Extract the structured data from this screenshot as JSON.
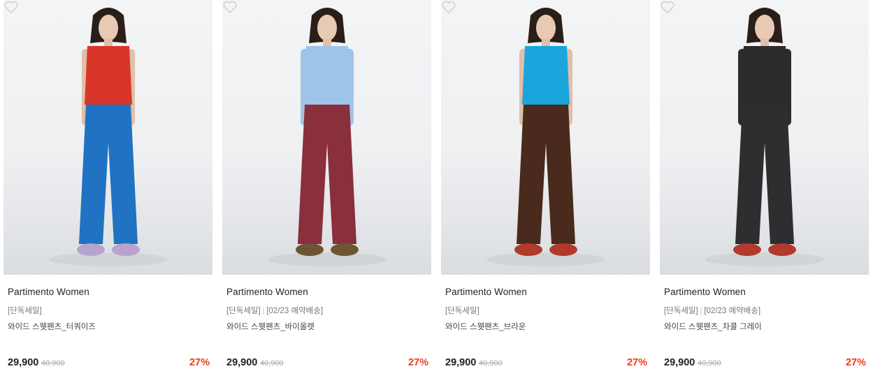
{
  "colors": {
    "discount": "#ee3c1d",
    "brand_text": "#222222",
    "muted": "#777777"
  },
  "products": [
    {
      "brand": "Partimento Women",
      "tag1": "[단독세일]",
      "tag2": "",
      "name": "와이드 스웻팬츠_터쿼이즈",
      "price": "29,900",
      "original_price": "40,900",
      "discount": "27%",
      "top_color": "#d8362a",
      "pants_color": "#1f73c2",
      "shoe_color": "#b7a4cc",
      "wishlist_icon": "heart-outline-icon"
    },
    {
      "brand": "Partimento Women",
      "tag1": "[단독세일]",
      "tag2": "[02/23 예약배송]",
      "name": "와이드 스웻팬츠_바이올렛",
      "price": "29,900",
      "original_price": "40,900",
      "discount": "27%",
      "top_color": "#9fc4ea",
      "pants_color": "#8a2f3c",
      "shoe_color": "#6b5535",
      "wishlist_icon": "heart-outline-icon"
    },
    {
      "brand": "Partimento Women",
      "tag1": "[단독세일]",
      "tag2": "",
      "name": "와이드 스웻팬츠_브라운",
      "price": "29,900",
      "original_price": "40,900",
      "discount": "27%",
      "top_color": "#1aa6dc",
      "pants_color": "#4a2a1c",
      "shoe_color": "#b23a2c",
      "wishlist_icon": "heart-outline-icon"
    },
    {
      "brand": "Partimento Women",
      "tag1": "[단독세일]",
      "tag2": "[02/23 예약배송]",
      "name": "와이드 스웻팬츠_차콜 그레이",
      "price": "29,900",
      "original_price": "40,900",
      "discount": "27%",
      "top_color": "#2c2b2d",
      "pants_color": "#2f2d30",
      "shoe_color": "#b23a2c",
      "wishlist_icon": "heart-outline-icon"
    }
  ]
}
